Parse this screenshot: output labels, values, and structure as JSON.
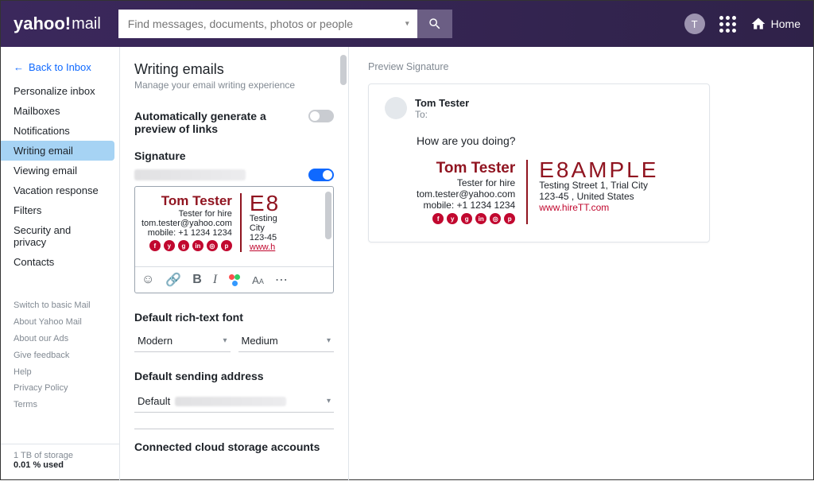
{
  "header": {
    "logo_brand": "yahoo!",
    "logo_product": "mail",
    "search_placeholder": "Find messages, documents, photos or people",
    "user_initial": "T",
    "home_label": "Home"
  },
  "sidebar": {
    "back_label": "Back to Inbox",
    "items": [
      {
        "label": "Personalize inbox"
      },
      {
        "label": "Mailboxes"
      },
      {
        "label": "Notifications"
      },
      {
        "label": "Writing email"
      },
      {
        "label": "Viewing email"
      },
      {
        "label": "Vacation response"
      },
      {
        "label": "Filters"
      },
      {
        "label": "Security and privacy"
      },
      {
        "label": "Contacts"
      }
    ],
    "footer": [
      {
        "label": "Switch to basic Mail"
      },
      {
        "label": "About Yahoo Mail"
      },
      {
        "label": "About our Ads"
      },
      {
        "label": "Give feedback"
      },
      {
        "label": "Help"
      },
      {
        "label": "Privacy Policy"
      },
      {
        "label": "Terms"
      }
    ],
    "storage_total": "1 TB of storage",
    "storage_used": "0.01 % used"
  },
  "settings": {
    "title": "Writing emails",
    "subtitle": "Manage your email writing experience",
    "link_preview_label": "Automatically generate a preview of links",
    "link_preview_on": false,
    "signature_label": "Signature",
    "signature_on": true,
    "font_section": "Default rich-text font",
    "font_family": "Modern",
    "font_size": "Medium",
    "sending_section": "Default sending address",
    "sending_default": "Default",
    "cloud_section": "Connected cloud storage accounts"
  },
  "signature": {
    "name": "Tom Tester",
    "tagline": "Tester for hire",
    "email": "tom.tester@yahoo.com",
    "mobile": "mobile: +1 1234 1234",
    "logo_text": "E8AMPLE",
    "addr1_editor": "Testing",
    "city_editor": "City",
    "zip_editor": "123-45",
    "web_editor": "www.h",
    "addr_full": "Testing Street 1, Trial City",
    "zip_country": "123-45 , United States",
    "website": "www.hireTT.com"
  },
  "preview": {
    "section_label": "Preview Signature",
    "from_name": "Tom Tester",
    "to_label": "To:",
    "message": "How are you doing?"
  }
}
